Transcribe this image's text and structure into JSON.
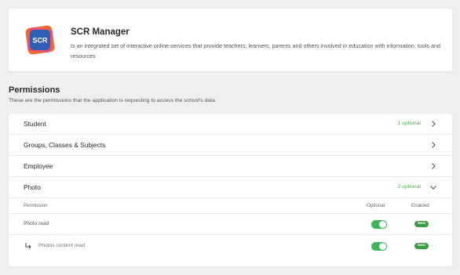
{
  "app": {
    "logo_text": "SCR",
    "title": "SCR Manager",
    "description": "Is an integrated set of interactive online services that provide teachers, learners, parents and others involved in education with information, tools and resources"
  },
  "permissions": {
    "title": "Permissions",
    "subtitle": "These are the permissions that the application is requesting to access the school's data.",
    "rows": [
      {
        "label": "Student",
        "optional": "1 optional",
        "icon": "chevron-right-icon",
        "expanded": false
      },
      {
        "label": "Groups, Classes & Subjects",
        "optional": "",
        "icon": "chevron-right-icon",
        "expanded": false
      },
      {
        "label": "Employee",
        "optional": "",
        "icon": "chevron-right-icon",
        "expanded": false
      },
      {
        "label": "Photo",
        "optional": "2 optional",
        "icon": "chevron-down-icon",
        "expanded": true
      }
    ],
    "table": {
      "headers": {
        "permission": "Permission",
        "optional": "Optional",
        "enabled": "Enabled"
      },
      "items": [
        {
          "label": "Photo read",
          "optional_on": true,
          "badge": "New"
        },
        {
          "label": "Photos content read",
          "optional_on": true,
          "badge": "New",
          "child_icon": "return-arrow-icon"
        }
      ]
    }
  },
  "colors": {
    "accent_green": "#4caf50",
    "toggle_green": "#3fb65a",
    "badge_green": "#3a9c44",
    "background": "#efefef"
  }
}
